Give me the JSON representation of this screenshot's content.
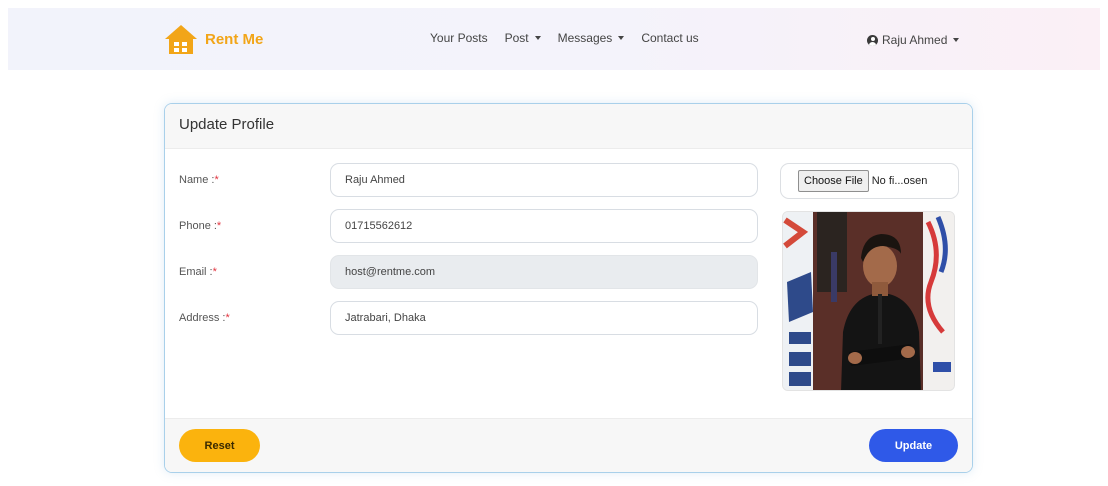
{
  "navbar": {
    "brand": "Rent Me",
    "links": [
      {
        "label": "Your Posts"
      },
      {
        "label": "Post"
      },
      {
        "label": "Messages"
      },
      {
        "label": "Contact us"
      }
    ],
    "user": "Raju Ahmed"
  },
  "card": {
    "title": "Update Profile",
    "fields": {
      "name": {
        "label": "Name :",
        "required": "*",
        "value": "Raju Ahmed"
      },
      "phone": {
        "label": "Phone :",
        "required": "*",
        "value": "01715562612"
      },
      "email": {
        "label": "Email :",
        "required": "*",
        "value": "host@rentme.com"
      },
      "address": {
        "label": "Address :",
        "required": "*",
        "value": "Jatrabari, Dhaka"
      }
    },
    "file": {
      "button": "Choose File",
      "filename": "No fi...osen"
    },
    "buttons": {
      "reset": "Reset",
      "update": "Update"
    }
  },
  "colors": {
    "brand": "#f2a518",
    "reset": "#fbb30d",
    "update": "#2f59e8",
    "required": "#e2343f"
  }
}
